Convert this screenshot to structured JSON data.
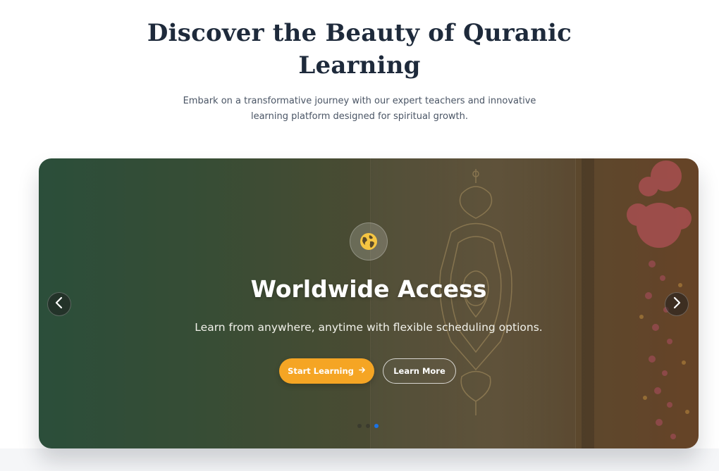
{
  "hero": {
    "title": "Discover the Beauty of Quranic Learning",
    "subtitle": "Embark on a transformative journey with our expert teachers and innovative learning platform designed for spiritual growth."
  },
  "carousel": {
    "slide": {
      "icon": "globe-icon",
      "title": "Worldwide Access",
      "description": "Learn from anywhere, anytime with flexible scheduling options.",
      "primary_button": "Start Learning",
      "primary_button_icon": "arrow-right-icon",
      "secondary_button": "Learn More"
    },
    "prev_icon": "chevron-left-icon",
    "next_icon": "chevron-right-icon",
    "dots_total": 3,
    "active_dot": 3
  },
  "colors": {
    "title": "#1e2a3b",
    "accent": "#f5a524",
    "active_dot": "#1a73e8",
    "icon": "#f5c542"
  }
}
